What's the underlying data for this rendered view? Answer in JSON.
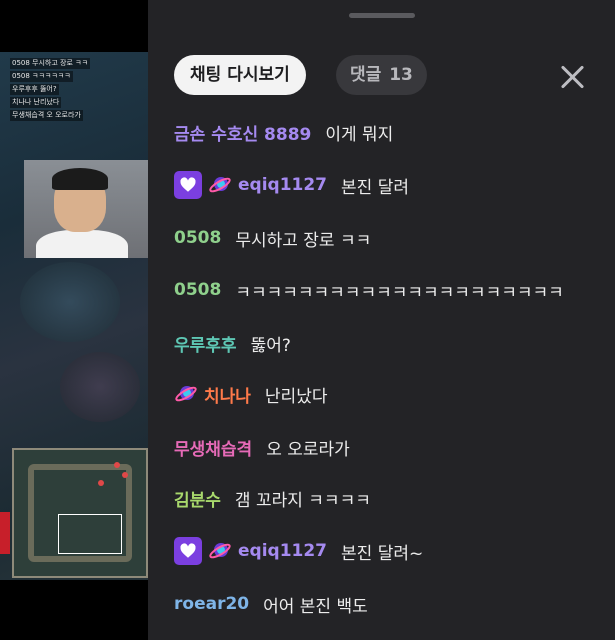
{
  "video": {
    "overlay_chat": [
      "0508 무시하고 장로 ㅋㅋ",
      "0508 ㅋㅋㅋㅋㅋㅋ",
      "우루후후 뚫어?",
      "치나나 난리났다",
      "무생채습격 오 오로라가"
    ]
  },
  "panel": {
    "tab_replay_label": "채팅 다시보기",
    "tab_comments_label": "댓글",
    "tab_comments_count": "13"
  },
  "colors": {
    "panel_bg": "#232326",
    "purple_nick": "#a58af0",
    "green_nick": "#8fd08c",
    "teal_nick": "#5ec7b4",
    "orange_nick": "#ff7a4a",
    "pink_nick": "#e66ab7",
    "lime_nick": "#a8d86c",
    "blue_nick": "#7fb5e8",
    "heart_badge": "#7b3fe0"
  },
  "messages": [
    {
      "nick": "금손 수호신 8889",
      "text": "이게 뭐지",
      "badges": []
    },
    {
      "nick": "eqiq1127",
      "text": "본진 달려",
      "badges": [
        "heart-badge-icon",
        "planet-badge-icon"
      ]
    },
    {
      "nick": "0508",
      "text": "무시하고 장로 ㅋㅋ",
      "badges": []
    },
    {
      "nick": "0508",
      "text": "ㅋㅋㅋㅋㅋㅋㅋㅋㅋㅋㅋㅋㅋㅋㅋㅋㅋㅋㅋㅋㅋ",
      "badges": []
    },
    {
      "nick": "우루후후",
      "text": "뚫어?",
      "badges": []
    },
    {
      "nick": "치나나",
      "text": "난리났다",
      "badges": [
        "planet-badge-icon"
      ]
    },
    {
      "nick": "무생채습격",
      "text": "오 오로라가",
      "badges": []
    },
    {
      "nick": "김분수",
      "text": "갬 꼬라지 ㅋㅋㅋㅋ",
      "badges": []
    },
    {
      "nick": "eqiq1127",
      "text": "본진 달려~",
      "badges": [
        "heart-badge-icon",
        "planet-badge-icon"
      ]
    },
    {
      "nick": "roear20",
      "text": "어어 본진 백도",
      "badges": []
    }
  ]
}
